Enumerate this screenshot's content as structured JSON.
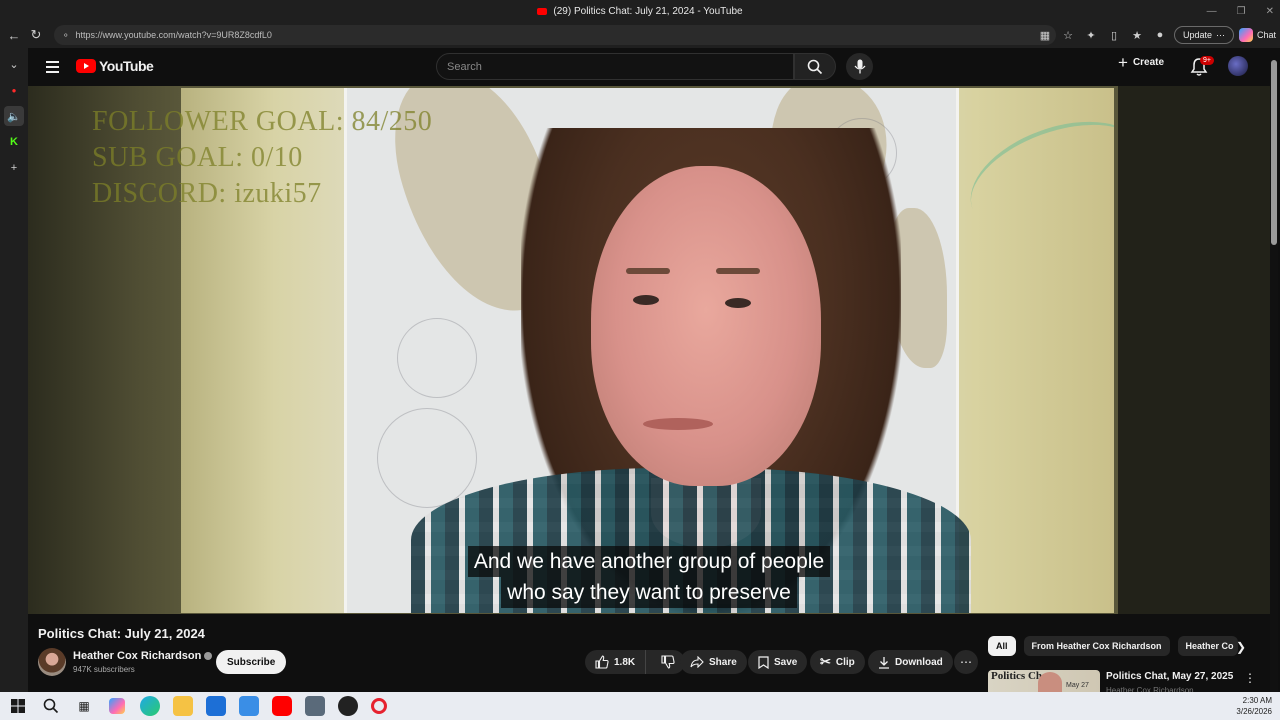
{
  "browser": {
    "tab_title": "(29) Politics Chat: July 21, 2024 - YouTube",
    "url": "https://www.youtube.com/watch?v=9UR8Z8cdfL0",
    "update_label": "Update",
    "chat_label": "Chat"
  },
  "youtube": {
    "logo_text": "YouTube",
    "search_placeholder": "Search",
    "create_label": "Create",
    "notification_count": "9+"
  },
  "video": {
    "overlay_lines": [
      "FOLLOWER GOAL: 84/250",
      "SUB GOAL: 0/10",
      "DISCORD: izuki57"
    ],
    "captions": [
      "And we have another group of people",
      "who say they want to preserve"
    ]
  },
  "details": {
    "title": "Politics Chat: July 21, 2024",
    "channel_name": "Heather Cox Richardson",
    "subscribers": "947K subscribers",
    "subscribe_label": "Subscribe",
    "like_count": "1.8K",
    "share_label": "Share",
    "save_label": "Save",
    "clip_label": "Clip",
    "download_label": "Download"
  },
  "sidebar": {
    "chips": [
      "All",
      "From Heather Cox Richardson",
      "Heather Co"
    ],
    "recommendation": {
      "title": "Politics Chat, May 27, 2025",
      "channel": "Heather Cox Richardson",
      "thumb_title": "Politics Chat",
      "thumb_date": "May 27"
    }
  },
  "taskbar": {
    "time": "2:30 AM",
    "date": "3/26/2026"
  },
  "colors": {
    "youtube_red": "#ff0000",
    "background": "#0f0f0f",
    "notification_badge": "#cc0000"
  }
}
